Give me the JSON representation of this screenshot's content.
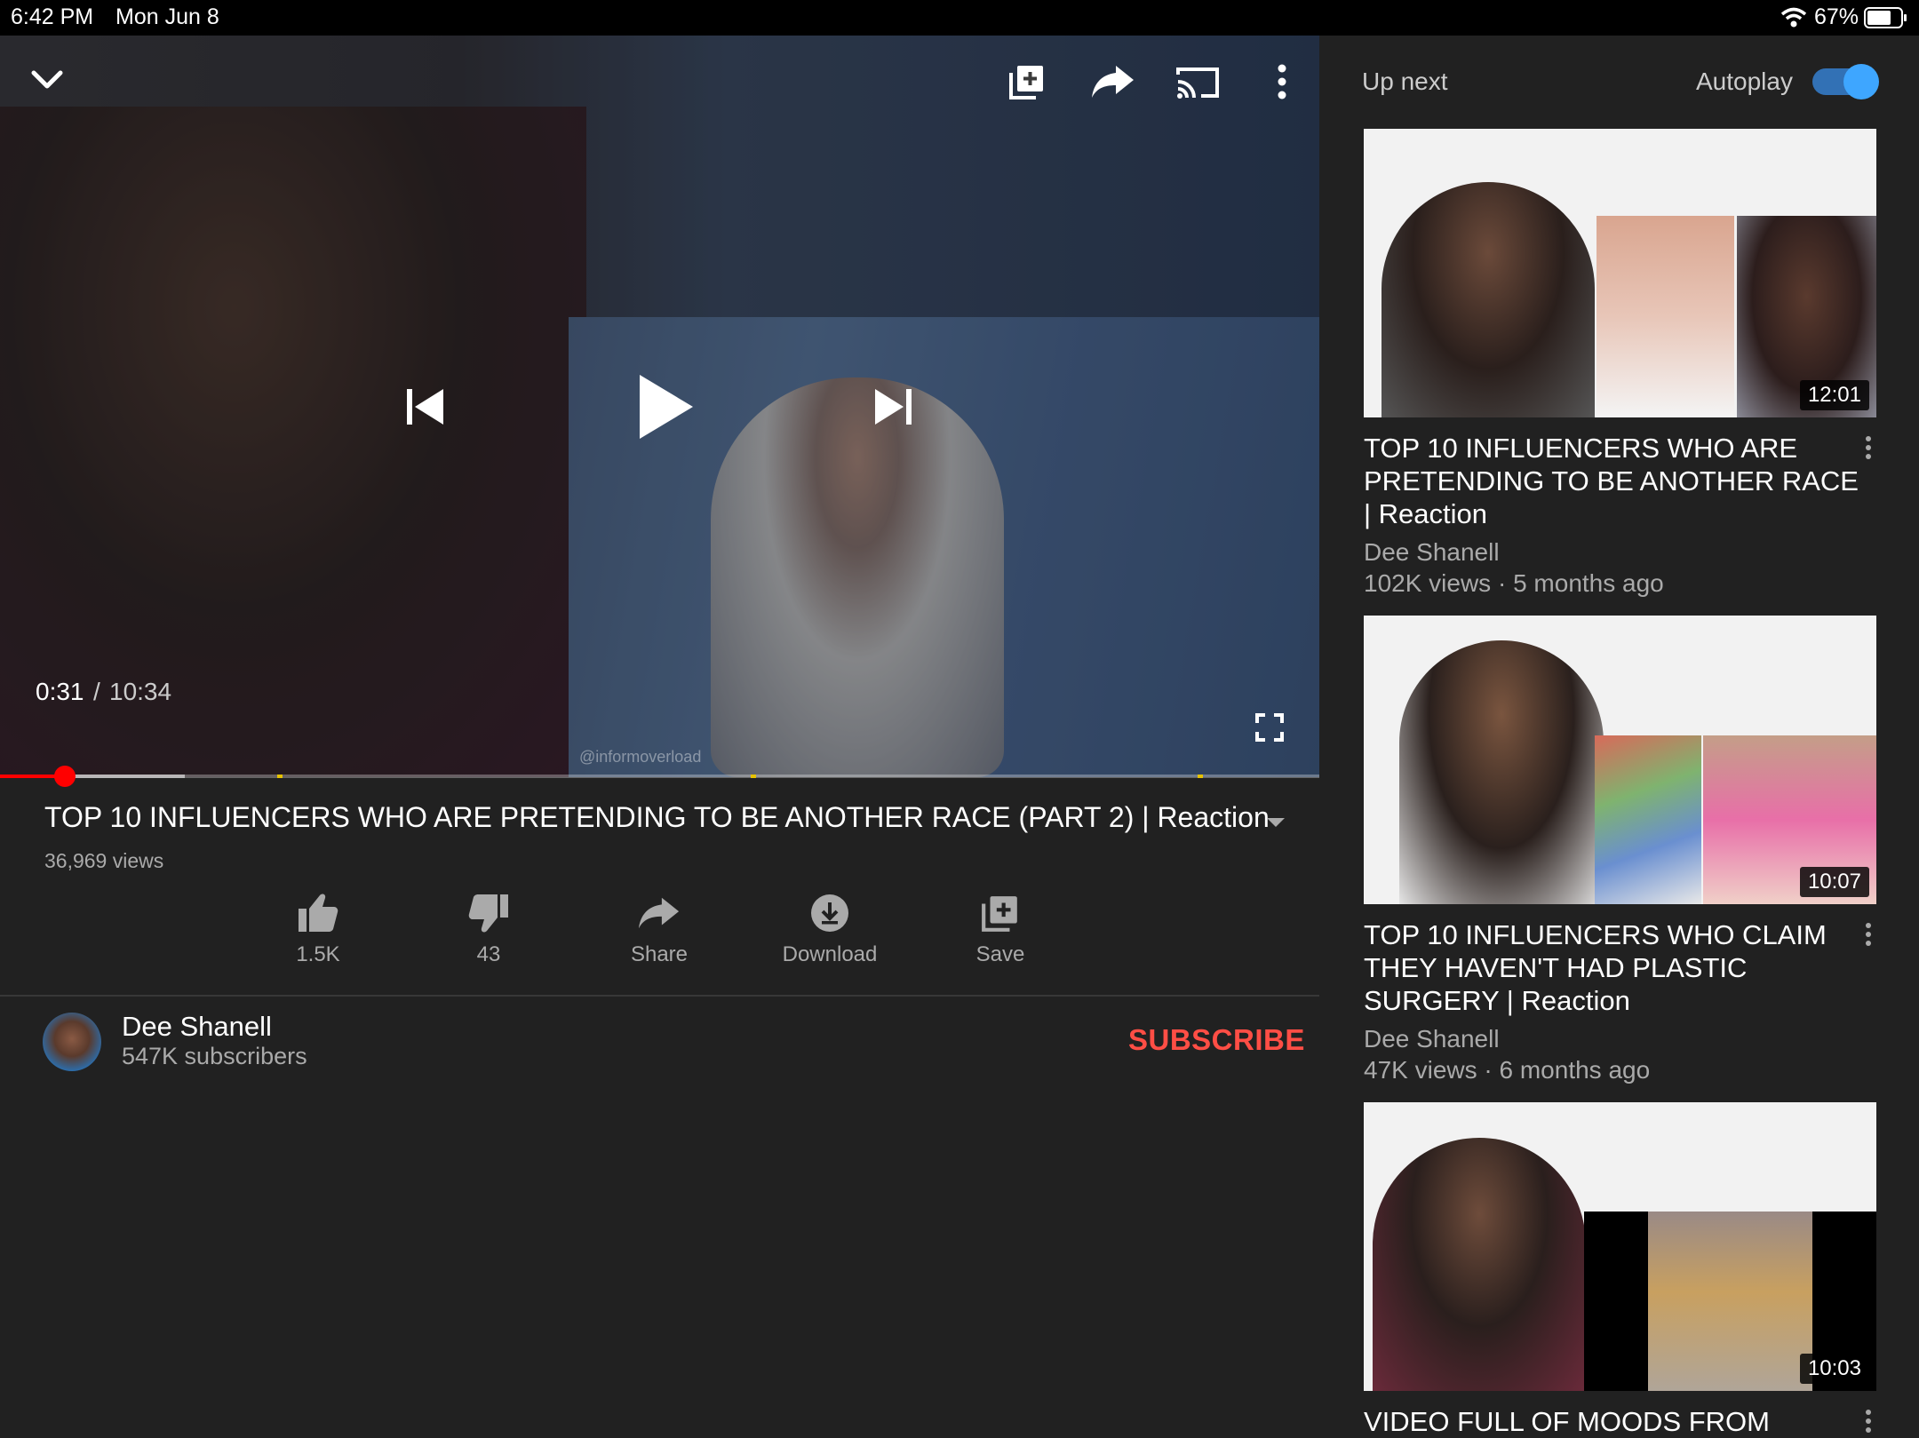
{
  "status_bar": {
    "time": "6:42 PM",
    "date": "Mon Jun 8",
    "battery": "67%",
    "icons": [
      "wifi-icon",
      "battery-icon"
    ]
  },
  "player": {
    "current_time": "0:31",
    "separator": "/",
    "duration": "10:34",
    "progress_fraction": 0.049,
    "buffered_fraction": 0.14,
    "watermark": "@informoverload",
    "icons": [
      "chevron-down-icon",
      "add-to-playlist-icon",
      "share-arrow-icon",
      "cast-icon",
      "more-vertical-icon",
      "previous-icon",
      "play-icon",
      "next-icon",
      "fullscreen-icon"
    ]
  },
  "video": {
    "title": "TOP 10 INFLUENCERS WHO ARE PRETENDING TO BE ANOTHER RACE (PART 2) | Reaction",
    "views": "36,969 views"
  },
  "actions": {
    "like": "1.5K",
    "dislike": "43",
    "share": "Share",
    "download": "Download",
    "save": "Save"
  },
  "channel": {
    "name": "Dee Shanell",
    "subscribers": "547K subscribers",
    "subscribe_label": "SUBSCRIBE"
  },
  "sidebar": {
    "up_next_label": "Up next",
    "autoplay_label": "Autoplay",
    "autoplay_on": true,
    "accent_color": "#3ea6ff",
    "cards": [
      {
        "duration": "12:01",
        "title": "TOP 10 INFLUENCERS WHO ARE PRETENDING TO BE ANOTHER RACE | Reaction",
        "channel": "Dee Shanell",
        "meta": "102K views · 5 months ago"
      },
      {
        "duration": "10:07",
        "title": "TOP 10 INFLUENCERS WHO CLAIM THEY HAVEN'T HAD PLASTIC SURGERY | Reaction",
        "channel": "Dee Shanell",
        "meta": "47K views · 6 months ago"
      },
      {
        "duration": "10:03",
        "title": "VIDEO FULL OF MOODS FROM"
      }
    ]
  },
  "colors": {
    "background": "#212121",
    "subscribe": "#ff4e45",
    "progress": "#ff0000"
  }
}
